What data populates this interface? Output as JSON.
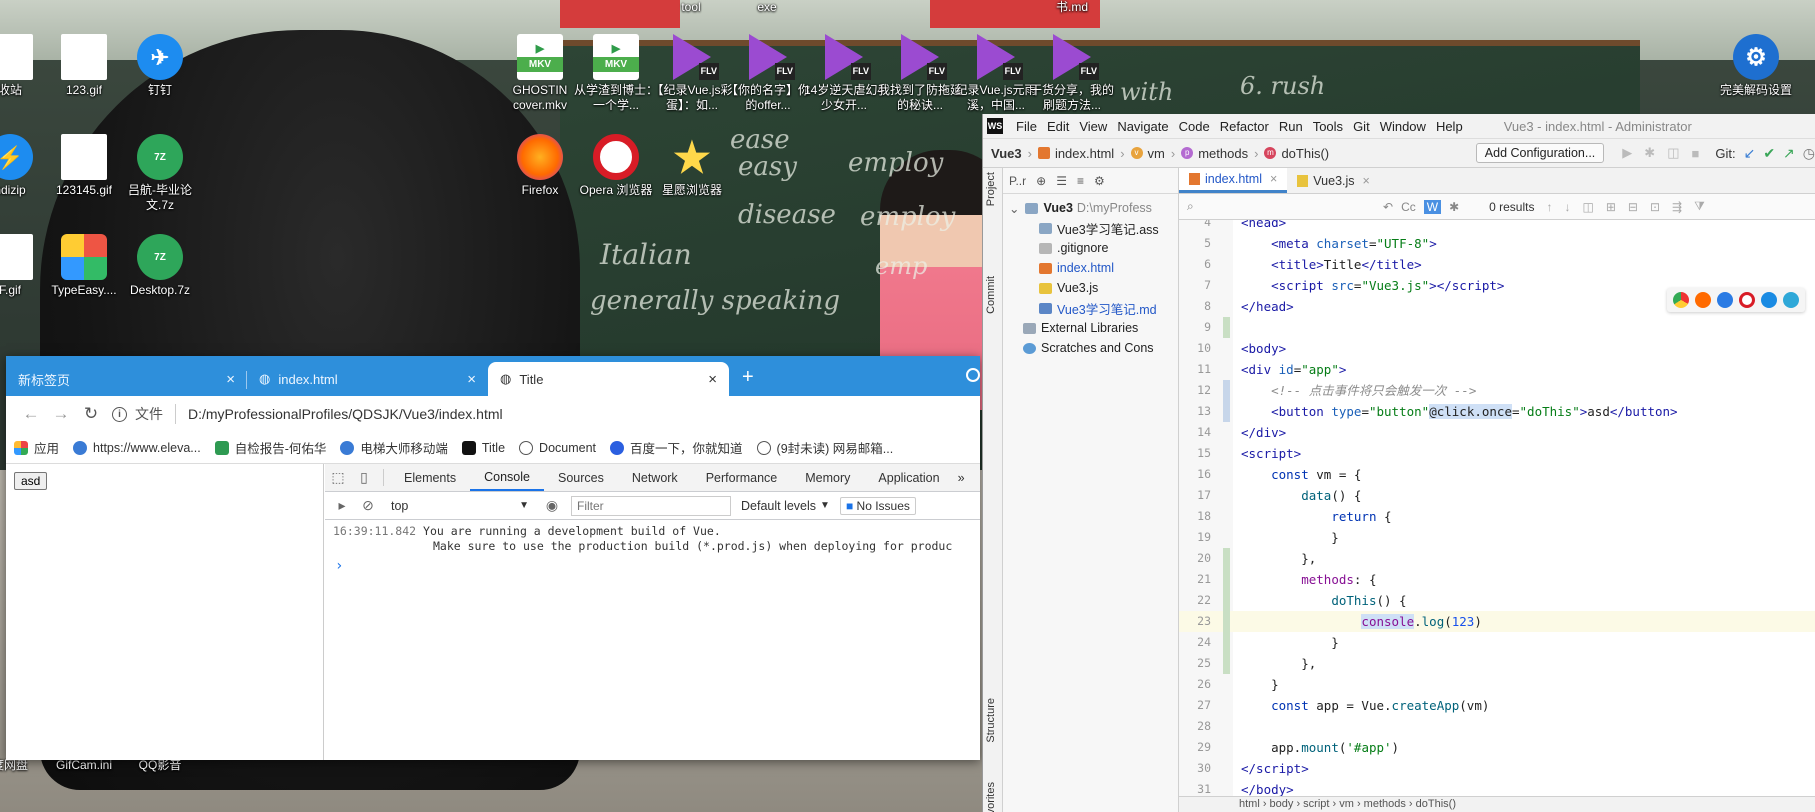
{
  "desktop": {
    "top_labels": [
      "tool",
      "exe",
      "书.md"
    ],
    "icons": [
      {
        "name": "mkv-ghostin",
        "label": "GHOSTIN cover.mkv",
        "type": "mkv",
        "badge": "MKV"
      },
      {
        "name": "mkv-learning",
        "label": "从学渣到博士：一个学...",
        "type": "mkv",
        "badge": "MKV"
      },
      {
        "name": "flv-vue",
        "label": "【纪录Vue.js彩蛋】：如...",
        "type": "flv",
        "badge": "FLV"
      },
      {
        "name": "flv-name",
        "label": "【你的名字】你的offer...",
        "type": "flv",
        "badge": "FLV"
      },
      {
        "name": "flv-14",
        "label": "14岁逆天虐幻4少女开...",
        "type": "flv",
        "badge": "FLV"
      },
      {
        "name": "flv-found",
        "label": "我找到了防拖延的秘诀...",
        "type": "flv",
        "badge": "FLV"
      },
      {
        "name": "flv-vuejs",
        "label": "纪录Vue.js元雨溪，中国...",
        "type": "flv",
        "badge": "FLV"
      },
      {
        "name": "flv-share",
        "label": "干货分享，我的刷题方法...",
        "type": "flv",
        "badge": "FLV"
      },
      {
        "name": "firefox",
        "label": "Firefox",
        "type": "ff"
      },
      {
        "name": "opera",
        "label": "Opera 浏览器",
        "type": "opera"
      },
      {
        "name": "star-browser",
        "label": "星愿浏览器",
        "type": "star"
      },
      {
        "name": "recycle",
        "label": "收站",
        "type": "gif"
      },
      {
        "name": "gif-123",
        "label": "123.gif",
        "type": "gif"
      },
      {
        "name": "dingding",
        "label": "钉钉",
        "type": "dd"
      },
      {
        "name": "bandizip",
        "label": "ndizip",
        "type": "dd"
      },
      {
        "name": "gif-123145",
        "label": "123145.gif",
        "type": "gif"
      },
      {
        "name": "z7-grad",
        "label": "吕航-毕业论文.7z",
        "type": "z7",
        "badge": "7Z"
      },
      {
        "name": "fgif",
        "label": "F.gif",
        "type": "gif"
      },
      {
        "name": "typeeasy",
        "label": "TypeEasy....",
        "type": "type"
      },
      {
        "name": "z7-desktop",
        "label": "Desktop.7z",
        "type": "z7",
        "badge": "7Z"
      },
      {
        "name": "netdisk",
        "label": "度网盘",
        "type": "dd"
      },
      {
        "name": "gifcam",
        "label": "GifCam.ini",
        "type": "gif"
      },
      {
        "name": "qqplayer",
        "label": "QQ影音",
        "type": "dd"
      },
      {
        "name": "gear-app",
        "label": "完美解码设置",
        "type": "gear"
      }
    ],
    "chalk": [
      "ease",
      "easy",
      "employ",
      "disease",
      "employ",
      "Italian",
      "generally speaking",
      "with",
      "6. rush",
      "emp"
    ]
  },
  "browser": {
    "tabs": [
      {
        "label": "新标签页",
        "active": false
      },
      {
        "label": "index.html",
        "active": false
      },
      {
        "label": "Title",
        "active": true
      }
    ],
    "new_tab": "+",
    "address": {
      "file_label": "文件",
      "url": "D:/myProfessionalProfiles/QDSJK/Vue3/index.html"
    },
    "bookmarks": [
      "应用",
      "https://www.eleva...",
      "自检报告-何佑华",
      "电梯大师移动端",
      "Title",
      "Document",
      "百度一下，你就知道",
      "(9封未读) 网易邮箱..."
    ],
    "page_button": "asd",
    "devtools": {
      "tabs": [
        "Elements",
        "Console",
        "Sources",
        "Network",
        "Performance",
        "Memory",
        "Application"
      ],
      "active_tab": "Console",
      "more": "»",
      "context": "top",
      "filter_placeholder": "Filter",
      "levels": "Default levels",
      "issues": "No Issues",
      "message_time": "16:39:11.842",
      "message_line1": "You are running a development build of Vue.",
      "message_line2": "Make sure to use the production build (*.prod.js) when deploying for produc",
      "prompt": "›"
    }
  },
  "ide": {
    "logo": "WS",
    "menu": [
      "File",
      "Edit",
      "View",
      "Navigate",
      "Code",
      "Refactor",
      "Run",
      "Tools",
      "Git",
      "Window",
      "Help"
    ],
    "caption": "Vue3 - index.html - Administrator",
    "breadcrumbs": [
      "Vue3",
      "index.html",
      "vm",
      "methods",
      "doThis()"
    ],
    "add_config": "Add Configuration...",
    "git_label": "Git:",
    "side_labels": [
      "Project",
      "Commit",
      "Structure",
      "Favorites"
    ],
    "project_toolbar": "P..r",
    "tree": [
      {
        "label": "Vue3",
        "extra": "D:\\myProfess",
        "kind": "root"
      },
      {
        "label": "Vue3学习笔记.ass",
        "kind": "folder"
      },
      {
        "label": ".gitignore",
        "kind": "file"
      },
      {
        "label": "index.html",
        "kind": "html"
      },
      {
        "label": "Vue3.js",
        "kind": "js"
      },
      {
        "label": "Vue3学习笔记.md",
        "kind": "md"
      },
      {
        "label": "External Libraries",
        "kind": "lib"
      },
      {
        "label": "Scratches and Cons",
        "kind": "scratch"
      }
    ],
    "editor_tabs": [
      {
        "label": "index.html",
        "active": true
      },
      {
        "label": "Vue3.js",
        "active": false
      }
    ],
    "search": {
      "results": "0 results",
      "cc": "Cc",
      "w": "W"
    },
    "code_lines": [
      {
        "n": "4",
        "html": "<span class=\"tag\">&lt;head&gt;</span>"
      },
      {
        "n": "5",
        "html": "    <span class=\"tag\">&lt;meta</span> <span class=\"attr\">charset</span>=<span class=\"str\">\"UTF-8\"</span><span class=\"tag\">&gt;</span>"
      },
      {
        "n": "6",
        "html": "    <span class=\"tag\">&lt;title&gt;</span>Title<span class=\"tag\">&lt;/title&gt;</span>"
      },
      {
        "n": "7",
        "html": "    <span class=\"tag\">&lt;script</span> <span class=\"attr\">src</span>=<span class=\"str\">\"Vue3.js\"</span><span class=\"tag\">&gt;&lt;/script&gt;</span>"
      },
      {
        "n": "8",
        "html": "<span class=\"tag\">&lt;/head&gt;</span>"
      },
      {
        "n": "9",
        "html": ""
      },
      {
        "n": "10",
        "html": "<span class=\"tag\">&lt;body&gt;</span>"
      },
      {
        "n": "11",
        "html": "<span class=\"tag\">&lt;div</span> <span class=\"attr\">id</span>=<span class=\"str\">\"app\"</span><span class=\"tag\">&gt;</span>"
      },
      {
        "n": "12",
        "html": "    <span class=\"cmt\">&lt;!-- 点击事件将只会触发一次 --&gt;</span>"
      },
      {
        "n": "13",
        "html": "    <span class=\"tag\">&lt;button</span> <span class=\"attr\">type</span>=<span class=\"str\">\"button\"</span><span class=\"hl\">@click.once</span>=<span class=\"str\">\"doThis\"</span><span class=\"tag\">&gt;</span>asd<span class=\"tag\">&lt;/button&gt;</span>"
      },
      {
        "n": "14",
        "html": "<span class=\"tag\">&lt;/div&gt;</span>"
      },
      {
        "n": "15",
        "html": "<span class=\"tag\">&lt;script&gt;</span>"
      },
      {
        "n": "16",
        "html": "    <span class=\"kw\">const</span> vm = {"
      },
      {
        "n": "17",
        "html": "        <span class=\"fn\">data</span>() {"
      },
      {
        "n": "18",
        "html": "            <span class=\"kw\">return</span> {"
      },
      {
        "n": "19",
        "html": "            }"
      },
      {
        "n": "20",
        "html": "        },"
      },
      {
        "n": "21",
        "html": "        <span class=\"prop\">methods</span>: {"
      },
      {
        "n": "22",
        "html": "            <span class=\"fn\">doThis</span>() {"
      },
      {
        "n": "23",
        "html": "                <span class=\"hl prop\">console</span>.<span class=\"fn\">log</span>(<span class=\"num\">123</span>)"
      },
      {
        "n": "24",
        "html": "            }"
      },
      {
        "n": "25",
        "html": "        },"
      },
      {
        "n": "26",
        "html": "    }"
      },
      {
        "n": "27",
        "html": "    <span class=\"kw\">const</span> app = Vue.<span class=\"fn\">createApp</span>(vm)"
      },
      {
        "n": "28",
        "html": ""
      },
      {
        "n": "29",
        "html": "    app.<span class=\"fn\">mount</span>(<span class=\"str\">'#app'</span>)"
      },
      {
        "n": "30",
        "html": "<span class=\"tag\">&lt;/script&gt;</span>"
      },
      {
        "n": "31",
        "html": "<span class=\"tag\">&lt;/body&gt;</span>"
      }
    ],
    "bottom_crumbs": "html › body › script › vm › methods › doThis()"
  },
  "colors": {
    "chrome_tab": "#2e8fdb",
    "ide_accent": "#4083c9",
    "console_link": "#1a73e8"
  }
}
